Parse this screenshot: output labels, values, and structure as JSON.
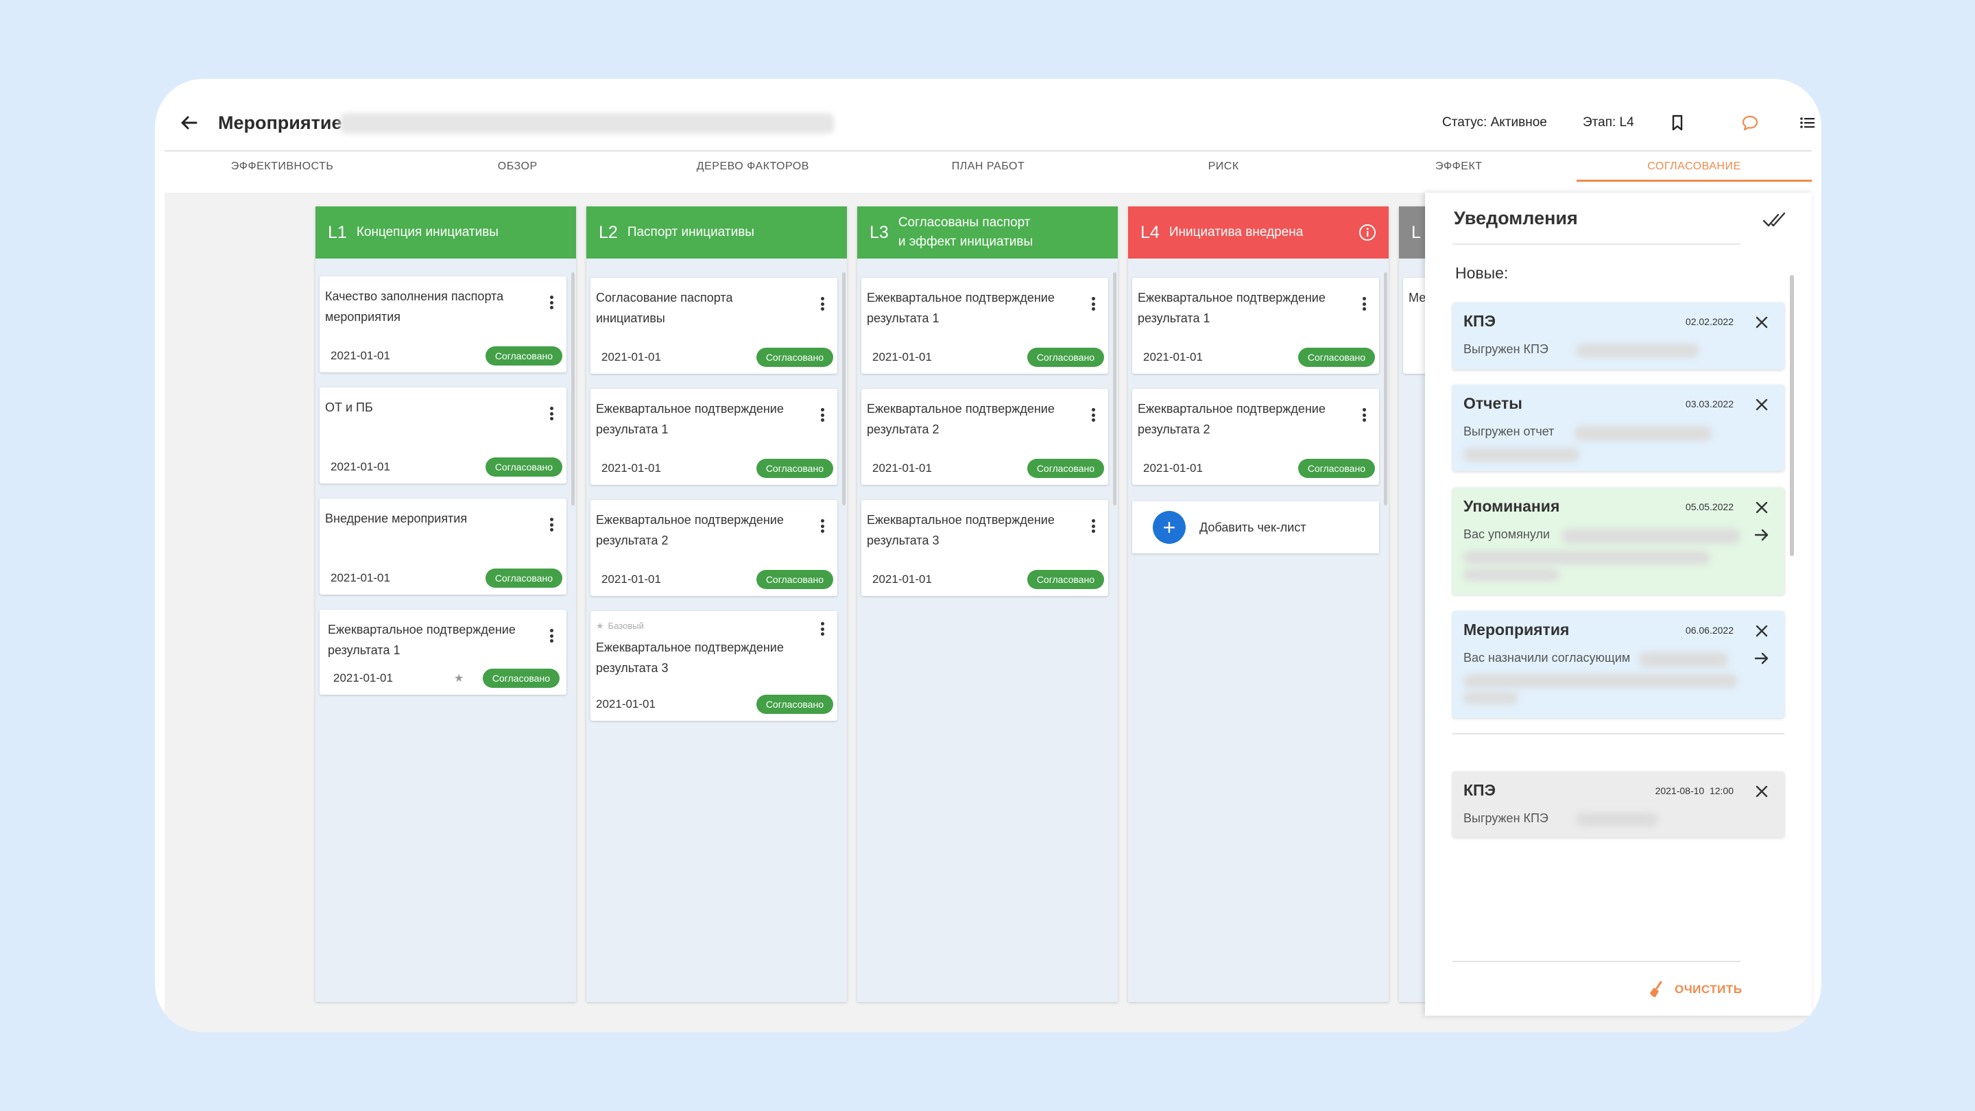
{
  "header": {
    "title": "Мероприятие",
    "status": "Статус: Активное",
    "stage": "Этап: L4"
  },
  "tabs": [
    "ЭФФЕКТИВНОСТЬ",
    "ОБЗОР",
    "ДЕРЕВО ФАКТОРОВ",
    "ПЛАН РАБОТ",
    "РИСК",
    "ЭФФЕКТ",
    "СОГЛАСОВАНИЕ"
  ],
  "active_tab": "СОГЛАСОВАНИЕ",
  "colors": {
    "accent": "#f08a4b",
    "green": "#4caf50",
    "red": "#f05454",
    "badge": "#43a047",
    "add_blue": "#1e73d6"
  },
  "columns": [
    {
      "level": "L1",
      "title": "Концепция инициативы",
      "cards": [
        {
          "title": "Качество заполнения паспорта мероприятия",
          "date": "2021-01-01",
          "status": "Согласовано"
        },
        {
          "title": "ОТ и ПБ",
          "date": "2021-01-01",
          "status": "Согласовано"
        },
        {
          "title": "Внедрение мероприятия",
          "date": "2021-01-01",
          "status": "Согласовано"
        },
        {
          "title": "Ежеквартальное подтверждение результата 1",
          "date": "2021-01-01",
          "status": "Согласовано"
        }
      ]
    },
    {
      "level": "L2",
      "title": "Паспорт инициативы",
      "cards": [
        {
          "title": "Согласование паспорта инициативы",
          "date": "2021-01-01",
          "status": "Согласовано"
        },
        {
          "title": "Ежеквартальное подтверждение результата 1",
          "date": "2021-01-01",
          "status": "Согласовано"
        },
        {
          "title": "Ежеквартальное подтверждение результата 2",
          "date": "2021-01-01",
          "status": "Согласовано"
        },
        {
          "label": "Базовый",
          "title": "Ежеквартальное подтверждение результата 3",
          "date": "2021-01-01",
          "status": "Согласовано"
        }
      ]
    },
    {
      "level": "L3",
      "title_line1": "Согласованы паспорт",
      "title_line2": "и эффект инициативы",
      "cards": [
        {
          "title": "Ежеквартальное подтверждение результата 1",
          "date": "2021-01-01",
          "status": "Согласовано"
        },
        {
          "title": "Ежеквартальное подтверждение результата 2",
          "date": "2021-01-01",
          "status": "Согласовано"
        },
        {
          "title": "Ежеквартальное подтверждение результата 3",
          "date": "2021-01-01",
          "status": "Согласовано"
        }
      ]
    },
    {
      "level": "L4",
      "title": "Инициатива внедрена",
      "cards": [
        {
          "title": "Ежеквартальное подтверждение результата 1",
          "date": "2021-01-01",
          "status": "Согласовано"
        },
        {
          "title": "Ежеквартальное подтверждение результата 2",
          "date": "2021-01-01",
          "status": "Согласовано"
        }
      ],
      "add_label": "Добавить чек-лист"
    },
    {
      "level": "L",
      "card_text": "Ме"
    }
  ],
  "notifications": {
    "title": "Уведомления",
    "new_label": "Новые:",
    "items": [
      {
        "title": "КПЭ",
        "date": "02.02.2022",
        "text": "Выгружен КПЭ"
      },
      {
        "title": "Отчеты",
        "date": "03.03.2022",
        "text": "Выгружен отчет"
      },
      {
        "title": "Упоминания",
        "date": "05.05.2022",
        "text": "Вас упомянули"
      },
      {
        "title": "Мероприятия",
        "date": "06.06.2022",
        "text": "Вас назначили согласующим"
      }
    ],
    "old": [
      {
        "title": "КПЭ",
        "date": "2021-08-10  12:00",
        "text": "Выгружен КПЭ"
      }
    ],
    "clear_label": "ОЧИСТИТЬ"
  }
}
